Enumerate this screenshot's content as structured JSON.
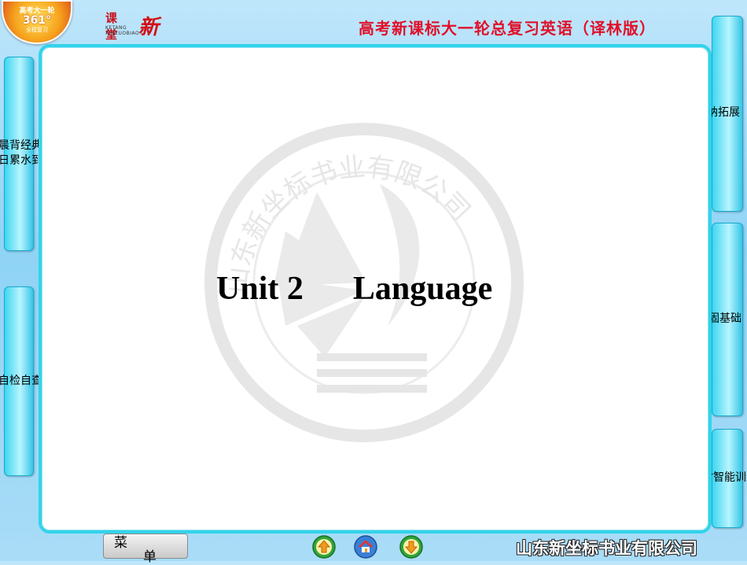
{
  "header": {
    "badge": {
      "line1": "高考大一轮",
      "line2": "361°",
      "line3": "全程复习"
    },
    "brand": {
      "line1": "课堂",
      "line2": "KETANG XINZUOBIAO",
      "main": "新坐标"
    },
    "course_title": "高考新课标大一轮总复习英语（译林版）"
  },
  "left_tabs": [
    {
      "line1": "晨背经典",
      "line2": "日累水到渠成"
    },
    {
      "line1": "自检自查夯实基础",
      "line2": ""
    }
  ],
  "right_tabs": [
    {
      "label": "考点突破归纳拓展"
    },
    {
      "label": "随堂落实巩固基础"
    },
    {
      "label": "课时智能训练"
    }
  ],
  "slide": {
    "title": "Unit 2      Language",
    "watermark_text": "山东新坐标书业有限公司"
  },
  "footer": {
    "menu": {
      "char1": "菜",
      "char2": "单"
    },
    "nav": [
      {
        "icon": "up-arrow-icon"
      },
      {
        "icon": "home-icon"
      },
      {
        "icon": "down-arrow-icon"
      }
    ],
    "publisher": "山东新坐标书业有限公司"
  },
  "colors": {
    "accent": "#33d3ea",
    "title_red": "#e0102a"
  }
}
